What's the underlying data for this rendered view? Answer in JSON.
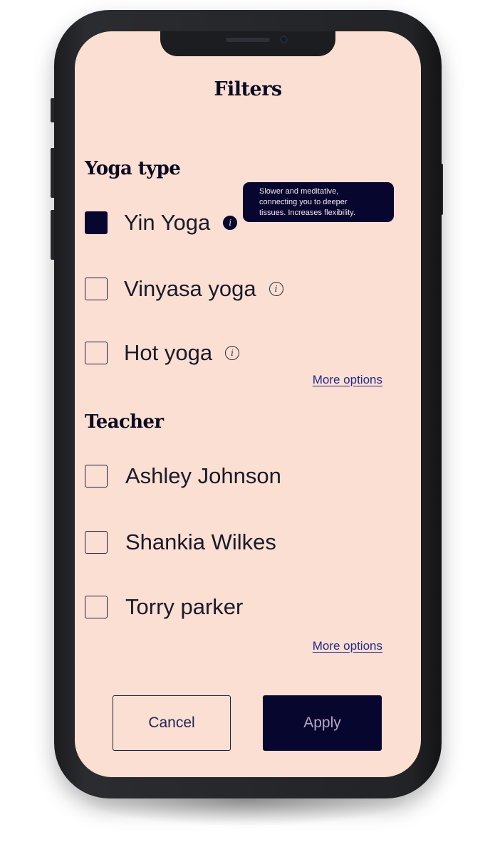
{
  "header": {
    "title": "Filters"
  },
  "yoga_type": {
    "heading": "Yoga type",
    "options": [
      {
        "label": "Yin Yoga",
        "checked": true,
        "info_icon": "info-icon"
      },
      {
        "label": "Vinyasa yoga",
        "checked": false,
        "info_icon": "info-icon"
      },
      {
        "label": "Hot yoga",
        "checked": false,
        "info_icon": "info-icon"
      }
    ],
    "tooltip": {
      "line1": "Slower and meditative,",
      "line2": "connecting you to deeper",
      "line3": "tissues. Increases flexibility."
    },
    "more_options": "More options"
  },
  "teacher": {
    "heading": "Teacher",
    "options": [
      {
        "label": "Ashley Johnson",
        "checked": false
      },
      {
        "label": "Shankia Wilkes",
        "checked": false
      },
      {
        "label": "Torry parker",
        "checked": false
      }
    ],
    "more_options": "More options"
  },
  "actions": {
    "cancel_label": "Cancel",
    "apply_label": "Apply"
  },
  "colors": {
    "screen_background": "#fbdfd2",
    "primary_navy": "#07062e",
    "link": "#262a8a",
    "phone_frame": "#222326"
  }
}
